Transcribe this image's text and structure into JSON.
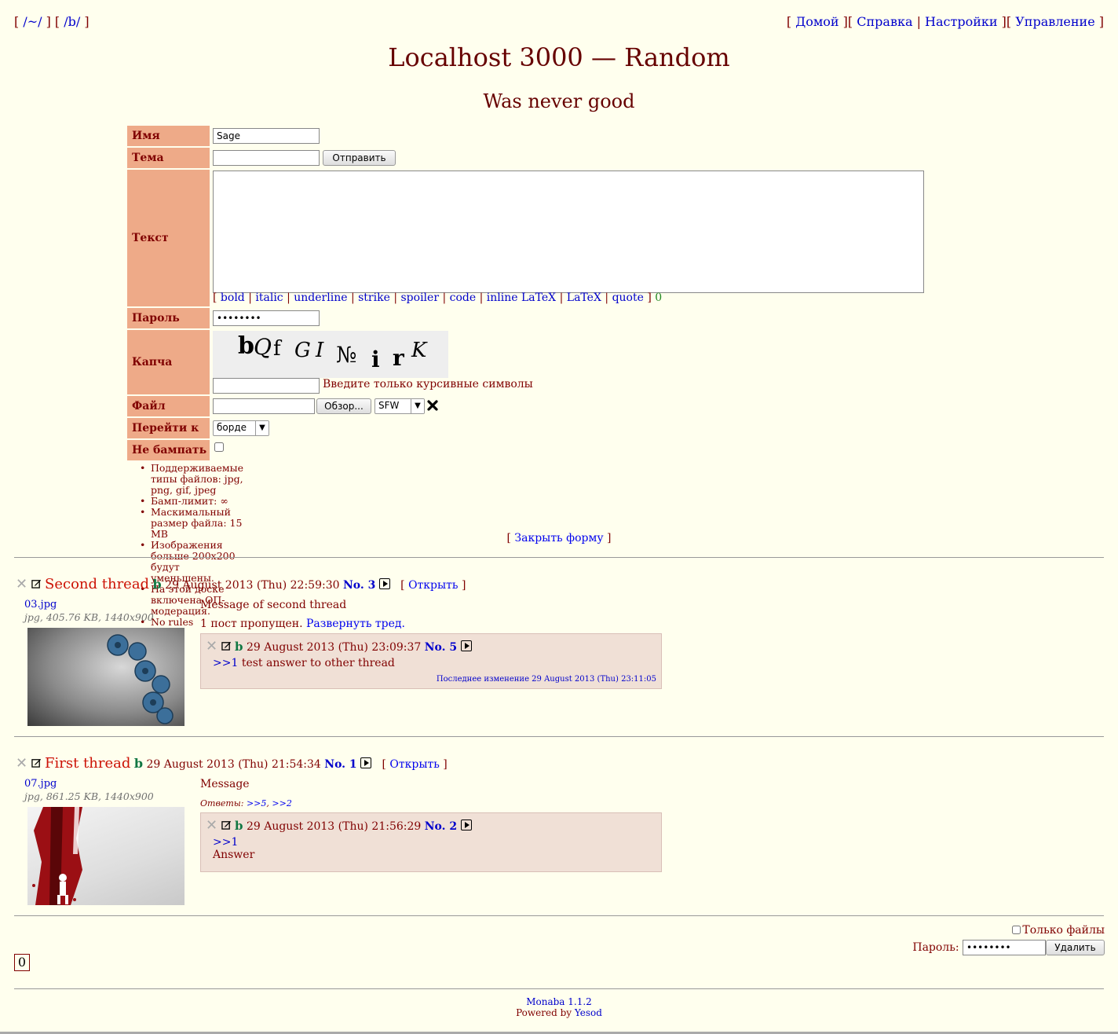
{
  "nav": {
    "boards": [
      "/~/",
      "/b/"
    ],
    "links": [
      "Домой",
      "Справка",
      "Настройки",
      "Управление"
    ]
  },
  "header": {
    "title": "Localhost 3000 — Random",
    "subtitle": "Was never good"
  },
  "form": {
    "labels": {
      "name": "Имя",
      "subject": "Тема",
      "text": "Текст",
      "password": "Пароль",
      "captcha": "Капча",
      "file": "Файл",
      "goto": "Перейти к",
      "nobump": "Не бампать"
    },
    "name_value": "Sage",
    "subject_value": "",
    "submit_label": "Отправить",
    "password_value": "••••••••",
    "markup_buttons": [
      "bold",
      "italic",
      "underline",
      "strike",
      "spoiler",
      "code",
      "inline LaTeX",
      "LaTeX",
      "quote"
    ],
    "char_count": "0",
    "captcha_chars": [
      "b",
      "Q",
      "f",
      "G",
      "I",
      "№",
      "i",
      "r",
      "K"
    ],
    "captcha_hint": "Введите только курсивные символы",
    "browse_label": "Обзор...",
    "rating_value": "SFW",
    "goto_value": "борде",
    "rules": [
      "Поддерживаемые типы файлов: jpg, png, gif, jpeg",
      "Бамп-лимит: ∞",
      "Маскимальный размер файла: 15 MB",
      "Изображения больше 200x200 будут уменьшены.",
      "На этой доске включена ОП-модерация.",
      "No rules"
    ],
    "close_form": "Закрыть форму"
  },
  "threads": [
    {
      "subject": "Second thread",
      "board": "b",
      "date": "29 August 2013 (Thu) 22:59:30",
      "no": "No. 3",
      "open_label": "Открыть",
      "file_name": "03.jpg",
      "file_info": "jpg, 405.76 KB, 1440x900",
      "message": "Message of second thread",
      "omitted": "1 пост пропущен.",
      "expand": "Развернуть тред.",
      "replies": [
        {
          "board": "b",
          "date": "29 August 2013 (Thu) 23:09:37",
          "no": "No. 5",
          "quote": ">>1",
          "text": "test answer to other thread",
          "last_modified": "Последнее изменение 29 August 2013 (Thu) 23:11:05"
        }
      ]
    },
    {
      "subject": "First thread",
      "board": "b",
      "date": "29 August 2013 (Thu) 21:54:34",
      "no": "No. 1",
      "open_label": "Открыть",
      "file_name": "07.jpg",
      "file_info": "jpg, 861.25 KB, 1440x900",
      "message": "Message",
      "answers_label": "Ответы:",
      "answers": [
        ">>5",
        ">>2"
      ],
      "replies": [
        {
          "board": "b",
          "date": "29 August 2013 (Thu) 21:56:29",
          "no": "No. 2",
          "quote": ">>1",
          "text": "Answer"
        }
      ]
    }
  ],
  "delete": {
    "only_files": "Только файлы",
    "password_label": "Пароль:",
    "password_value": "••••••••",
    "delete_button": "Удалить"
  },
  "pagination": {
    "current": "0"
  },
  "footer": {
    "engine": "Monaba 1.1.2",
    "powered_by": "Powered by",
    "framework": "Yesod"
  }
}
